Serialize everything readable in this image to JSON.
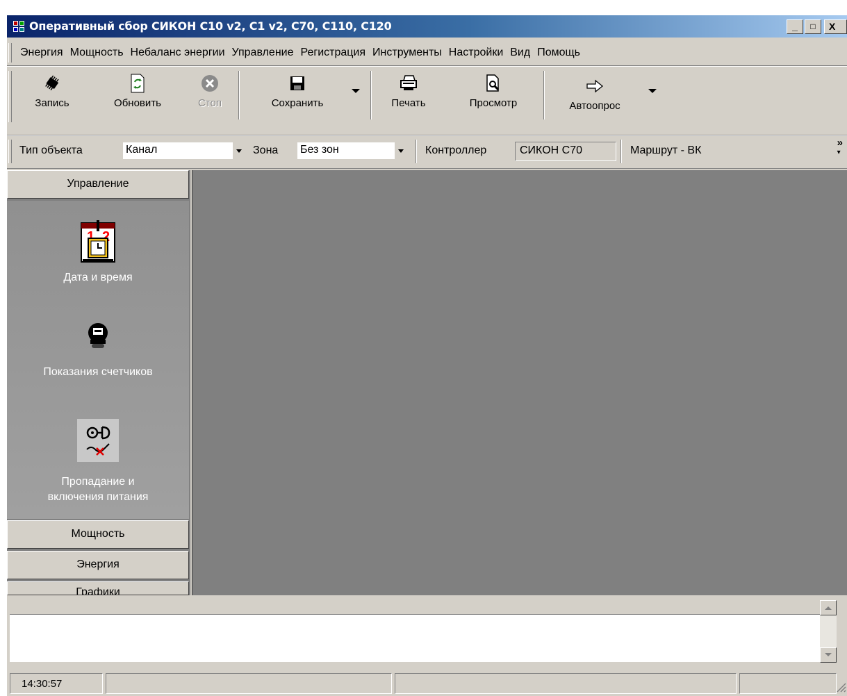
{
  "window": {
    "title": "Оперативный сбор СИКОН С10 v2, С1 v2, С70, С110, С120",
    "icon": "app-icon",
    "controls": {
      "minimize": "_",
      "maximize": "□",
      "close": "X"
    }
  },
  "menu": {
    "items": [
      "Энергия",
      "Мощность",
      "Небаланс энергии",
      "Управление",
      "Регистрация",
      "Инструменты",
      "Настройки",
      "Вид",
      "Помощь"
    ]
  },
  "toolbar": {
    "record": {
      "label": "Запись",
      "icon": "chip-icon"
    },
    "refresh": {
      "label": "Обновить",
      "icon": "refresh-icon"
    },
    "stop": {
      "label": "Стоп",
      "icon": "stop-icon",
      "disabled": true
    },
    "save": {
      "label": "Сохранить",
      "icon": "floppy-icon"
    },
    "print": {
      "label": "Печать",
      "icon": "printer-icon"
    },
    "preview": {
      "label": "Просмотр",
      "icon": "preview-icon"
    },
    "autopoll": {
      "label": "Автоопрос",
      "icon": "arrow-right-icon"
    }
  },
  "filter": {
    "object_type_label": "Тип объекта",
    "object_type_value": "Канал",
    "zone_label": "Зона",
    "zone_value": "Без зон",
    "controller_label": "Контроллер",
    "controller_value": "СИКОН С70",
    "route_label": "Маршрут",
    "route_value": " - ВК",
    "overflow": "»"
  },
  "sidebar": {
    "active_group": "Управление",
    "items": [
      {
        "label": "Дата и время",
        "icon": "calendar-clock-icon"
      },
      {
        "label": "Показания счетчиков",
        "icon": "meter-icon"
      },
      {
        "label_line1": "Пропадание и",
        "label_line2": "включения питания",
        "icon": "power-plug-icon"
      }
    ],
    "groups_below": [
      "Мощность",
      "Энергия",
      "Графики"
    ]
  },
  "statusbar": {
    "time": "14:30:57"
  },
  "colors": {
    "face": "#d4d0c8",
    "workspace": "#808080",
    "title_start": "#0a246a",
    "title_end": "#a6caf0"
  }
}
